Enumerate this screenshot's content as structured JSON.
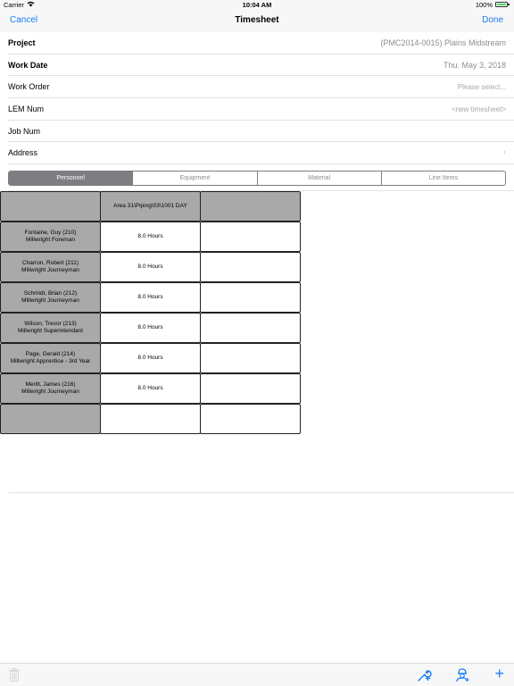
{
  "status_bar": {
    "carrier": "Carrier",
    "time": "10:04 AM",
    "battery": "100%"
  },
  "nav": {
    "cancel": "Cancel",
    "title": "Timesheet",
    "done": "Done"
  },
  "form": {
    "project": {
      "label": "Project",
      "value": "(PMC2014-0015) Plains Midstream"
    },
    "work_date": {
      "label": "Work Date",
      "value": "Thu. May 3, 2018"
    },
    "work_order": {
      "label": "Work Order",
      "placeholder": "Please select..."
    },
    "lem_num": {
      "label": "LEM Num",
      "value": "<new timesheet>"
    },
    "job_num": {
      "label": "Job Num",
      "value": ""
    },
    "address": {
      "label": "Address"
    }
  },
  "tabs": [
    {
      "label": "Personnel",
      "active": true
    },
    {
      "label": "Equipment",
      "active": false
    },
    {
      "label": "Material",
      "active": false
    },
    {
      "label": "Line Items",
      "active": false
    }
  ],
  "grid": {
    "column_headers": [
      "",
      "Area 31\\Piping\\03\\1001 DAY",
      ""
    ],
    "rows": [
      {
        "name": "Fontaine, Guy (210)",
        "role": "Millwright Foreman",
        "hours": "8.0 Hours",
        "extra": ""
      },
      {
        "name": "Charron, Robert (211)",
        "role": "Millwright Journeyman",
        "hours": "8.0 Hours",
        "extra": ""
      },
      {
        "name": "Schmidt, Brian (212)",
        "role": "Millwright Journeyman",
        "hours": "8.0 Hours",
        "extra": ""
      },
      {
        "name": "Wilson, Trevor (213)",
        "role": "Millwright Superintendant",
        "hours": "8.0 Hours",
        "extra": ""
      },
      {
        "name": "Page, Gerald (214)",
        "role": "Millwright Apprentice - 3rd Year",
        "hours": "8.0 Hours",
        "extra": ""
      },
      {
        "name": "Meritt, James (216)",
        "role": "Millwright Journeyman",
        "hours": "8.0 Hours",
        "extra": ""
      },
      {
        "name": "",
        "role": "",
        "hours": "",
        "extra": ""
      }
    ]
  },
  "toolbar": {
    "icons": [
      "trash-icon",
      "wrench-add-icon",
      "worker-add-icon",
      "plus-icon"
    ],
    "plus": "+"
  },
  "colors": {
    "accent": "#1a7cf5",
    "header_cell": "#a9a9a9",
    "active_tab": "#7d7d82"
  }
}
